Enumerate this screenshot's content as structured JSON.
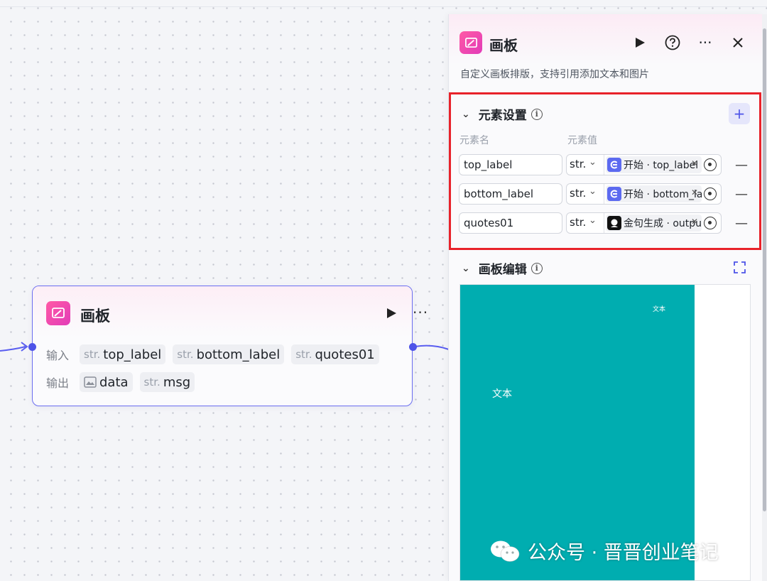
{
  "node": {
    "title": "画板",
    "input_label": "输入",
    "output_label": "输出",
    "inputs": [
      {
        "type": "str.",
        "name": "top_label"
      },
      {
        "type": "str.",
        "name": "bottom_label"
      },
      {
        "type": "str.",
        "name": "quotes01"
      }
    ],
    "outputs": [
      {
        "type": "image",
        "name": "data"
      },
      {
        "type": "str.",
        "name": "msg"
      }
    ]
  },
  "panel": {
    "title": "画板",
    "description": "自定义画板排版，支持引用添加文本和图片",
    "elements_section": {
      "title": "元素设置",
      "col_name": "元素名",
      "col_value": "元素值",
      "rows": [
        {
          "name": "top_label",
          "type": "str.",
          "ref_icon": "start-icon",
          "ref_text": "开始 · top_label"
        },
        {
          "name": "bottom_label",
          "type": "str.",
          "ref_icon": "start-icon",
          "ref_text": "开始 · bottom_label"
        },
        {
          "name": "quotes01",
          "type": "str.",
          "ref_icon": "bot-icon",
          "ref_text": "金句生成 · output"
        }
      ]
    },
    "canvas_section": {
      "title": "画板编辑",
      "text_small": "文本",
      "text_main": "文本",
      "canvas_color": "#00adb0"
    }
  },
  "watermark": "公众号 · 晋晋创业笔记",
  "colors": {
    "accent": "#4d53e8",
    "highlight": "#e8222a",
    "app_icon": "#e23bb8"
  }
}
